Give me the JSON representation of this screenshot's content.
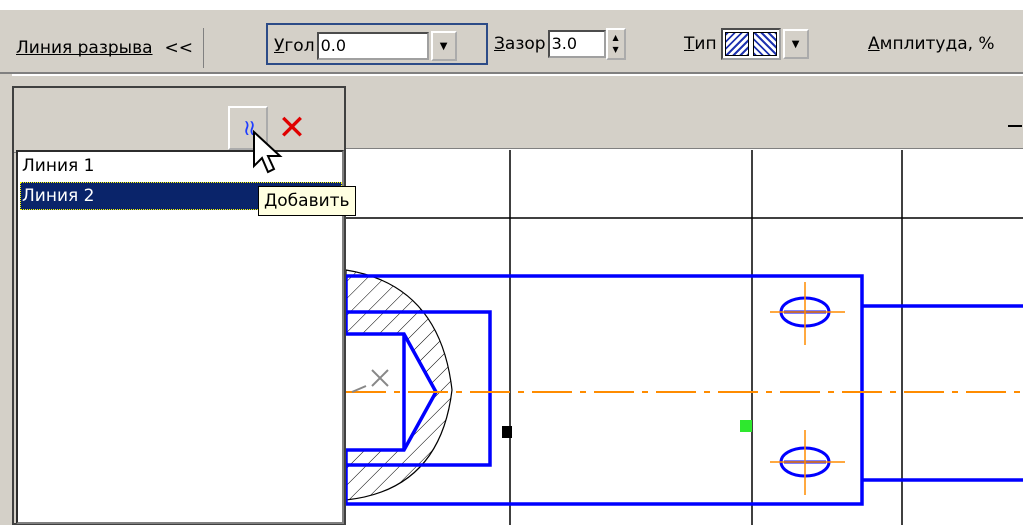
{
  "toolbar": {
    "break_line_label": "Линия разрыва",
    "collapse_label": "<<",
    "angle_label_u": "У",
    "angle_label_rest": "гол",
    "angle_value": "0.0",
    "gap_label_u": "З",
    "gap_label_rest": "азор",
    "gap_value": "3.0",
    "type_label_u": "Т",
    "type_label_rest": "ип",
    "amplitude_label_u": "А",
    "amplitude_label_rest": "мплитуда, %"
  },
  "panel": {
    "add_icon": "break-line-icon",
    "delete_icon": "delete-icon",
    "items": [
      {
        "label": "Линия 1",
        "selected": false
      },
      {
        "label": "Линия 2",
        "selected": true
      }
    ]
  },
  "tooltip": {
    "text": "Добавить"
  },
  "colors": {
    "drawing_blue": "#0000ff",
    "axis_orange": "#ff8c00",
    "selection": "#0a246a",
    "marker_green": "#2ee82e",
    "ui_gray": "#d4d0c8"
  }
}
